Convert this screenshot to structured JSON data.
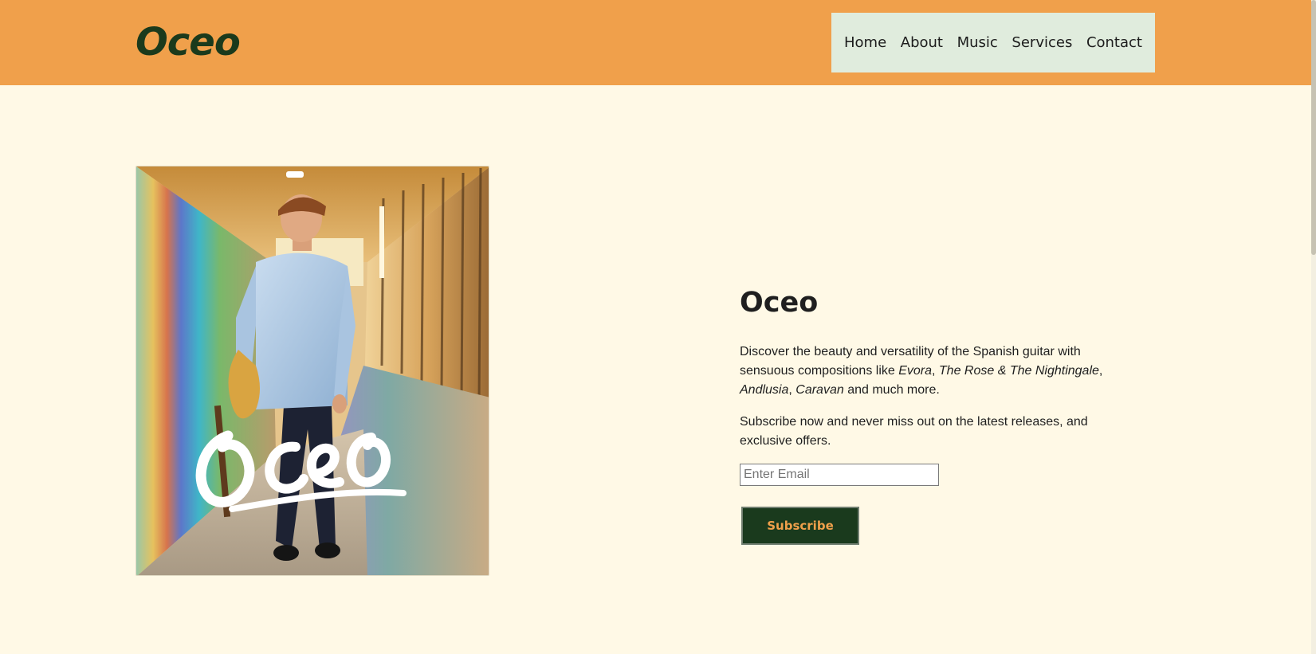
{
  "header": {
    "logo": "Oceo",
    "nav": [
      {
        "label": "Home"
      },
      {
        "label": "About"
      },
      {
        "label": "Music"
      },
      {
        "label": "Services"
      },
      {
        "label": "Contact"
      }
    ]
  },
  "hero": {
    "image_overlay_text": "Oceo"
  },
  "main": {
    "title": "Oceo",
    "description": {
      "intro": "Discover the beauty and versatility of the Spanish guitar with sensuous compositions like ",
      "song_1": "Evora",
      "sep_1": ", ",
      "song_2": "The Rose & The Nightingale",
      "sep_2": ", ",
      "song_3": "Andlusia",
      "sep_3": ", ",
      "song_4": "Caravan",
      "outro": " and much more."
    },
    "subscribe_text": "Subscribe now and never miss out on the latest releases, and exclusive offers.",
    "email_placeholder": "Enter Email",
    "subscribe_label": "Subscribe"
  },
  "colors": {
    "header_bg": "#f0a04b",
    "page_bg": "#fff9e6",
    "nav_bg": "#e0ecdd",
    "brand_dark": "#1b3a1c",
    "button_text": "#f0a04b"
  }
}
